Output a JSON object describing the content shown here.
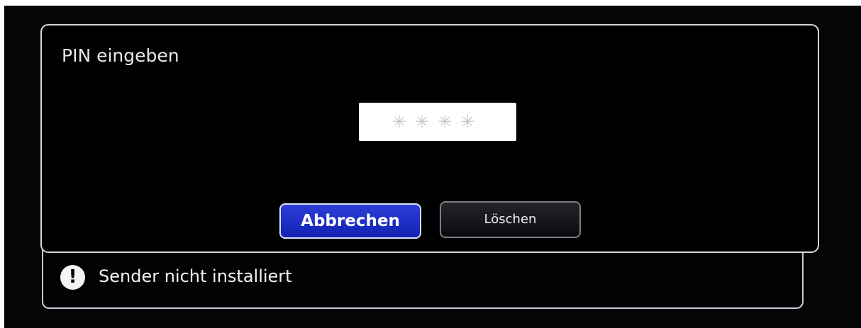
{
  "dialog": {
    "title": "PIN eingeben",
    "pin_mask": "✳✳✳✳",
    "buttons": {
      "cancel": "Abbrechen",
      "delete": "Löschen"
    }
  },
  "notice": {
    "icon": "exclamation-icon",
    "icon_glyph": "!",
    "message": "Sender nicht installiert"
  }
}
